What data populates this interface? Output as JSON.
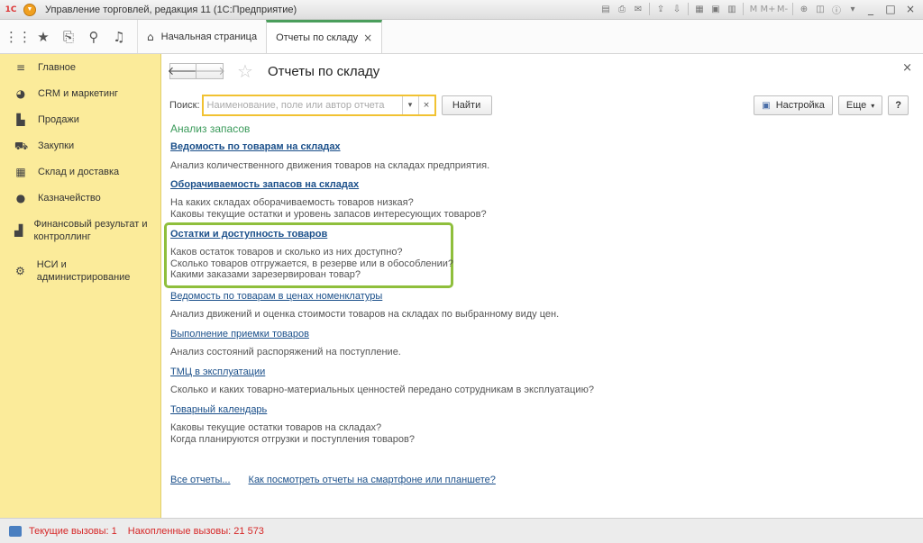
{
  "titlebar": {
    "logo": "1С",
    "title": "Управление торговлей, редакция 11  (1С:Предприятие)",
    "tools": [
      "save-icon",
      "print-icon",
      "mail-icon",
      "upload-icon",
      "download-icon",
      "spreadsheet-icon",
      "calendar-icon",
      "calculator-icon"
    ],
    "m_labels": [
      "M",
      "M+",
      "M-"
    ],
    "win": [
      "_",
      "□",
      "×"
    ]
  },
  "tabbar": {
    "icons": [
      "apps-grid-icon",
      "star-icon",
      "history-icon",
      "search-icon",
      "bell-icon"
    ],
    "home_label": "Начальная страница",
    "active_label": "Отчеты по складу"
  },
  "sidebar": {
    "items": [
      {
        "icon": "menu-icon",
        "label": "Главное"
      },
      {
        "icon": "crm-icon",
        "label": "CRM и маркетинг"
      },
      {
        "icon": "bag-icon",
        "label": "Продажи"
      },
      {
        "icon": "cart-icon",
        "label": "Закупки"
      },
      {
        "icon": "warehouse-icon",
        "label": "Склад и доставка"
      },
      {
        "icon": "coin-icon",
        "label": "Казначейство"
      },
      {
        "icon": "chart-icon",
        "label": "Финансовый результат и контроллинг"
      },
      {
        "icon": "gear-icon",
        "label": "НСИ и администрирование"
      }
    ]
  },
  "main": {
    "title": "Отчеты по складу",
    "search": {
      "label": "Поиск:",
      "placeholder": "Наименование, поле или автор отчета",
      "value": "",
      "find_label": "Найти"
    },
    "settings_label": "Настройка",
    "more_label": "Еще",
    "help_label": "?",
    "section_title": "Анализ запасов",
    "reports": [
      {
        "title": "Ведомость по товарам на складах",
        "desc": "Анализ количественного движения товаров на складах предприятия."
      },
      {
        "title": "Оборачиваемость запасов на складах",
        "desc": "На каких складах оборачиваемость товаров низкая?\nКаковы текущие остатки и уровень запасов интересующих товаров?"
      },
      {
        "title": "Остатки и доступность товаров",
        "desc": "Каков остаток товаров и сколько из них доступно?\nСколько товаров отгружается, в резерве или в обособлении?\nКакими заказами зарезервирован товар?"
      },
      {
        "title": "Ведомость по товарам в ценах номенклатуры",
        "desc": "Анализ движений и оценка стоимости товаров на складах по выбранному виду цен."
      },
      {
        "title": "Выполнение приемки товаров",
        "desc": "Анализ состояний распоряжений на поступление."
      },
      {
        "title": "ТМЦ в эксплуатации",
        "desc": "Сколько и каких товарно-материальных ценностей передано сотрудникам в эксплуатацию?"
      },
      {
        "title": "Товарный календарь",
        "desc": "Каковы текущие остатки товаров на складах?\nКогда планируются отгрузки и поступления товаров?"
      }
    ],
    "bottom_links": {
      "all_reports": "Все отчеты...",
      "mobile_help": "Как посмотреть отчеты на смартфоне или планшете?"
    }
  },
  "statusbar": {
    "current_calls": "Текущие вызовы: 1",
    "accumulated_calls": "Накопленные вызовы: 21 573"
  }
}
